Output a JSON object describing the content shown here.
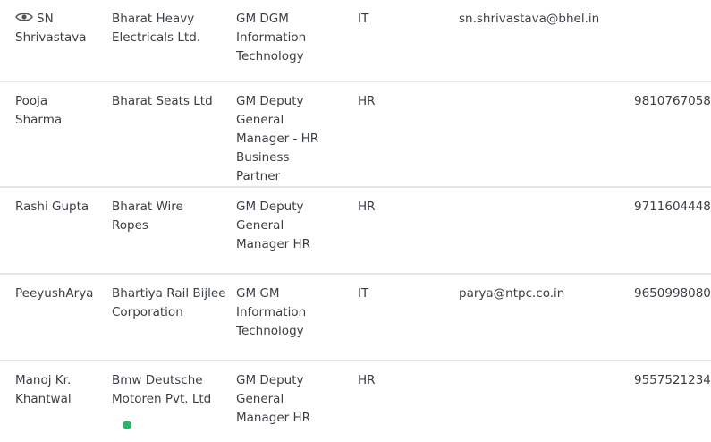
{
  "rows": [
    {
      "name_line1": "SN",
      "name_line2": "Shrivastava",
      "company": "Bharat Heavy Electricals Ltd.",
      "designation": "GM DGM Information Technology",
      "department": "IT",
      "email": "sn.shrivastava@bhel.in",
      "phone": ""
    },
    {
      "name": "Pooja Sharma",
      "company": "Bharat Seats Ltd",
      "designation": "GM Deputy General Manager - HR Business Partner",
      "department": "HR",
      "email": "",
      "phone": "9810767058"
    },
    {
      "name": "Rashi Gupta",
      "company": "Bharat Wire Ropes",
      "designation": "GM Deputy General Manager HR",
      "department": "HR",
      "email": "",
      "phone": "9711604448"
    },
    {
      "name": "PeeyushArya",
      "company": "Bhartiya Rail Bijlee Corporation",
      "designation": "GM GM Information Technology",
      "department": "IT",
      "email": "parya@ntpc.co.in",
      "phone": "9650998080"
    },
    {
      "name": "Manoj Kr. Khantwal",
      "company": "Bmw Deutsche Motoren Pvt. Ltd",
      "designation": "GM Deputy General Manager HR",
      "department": "HR",
      "email": "",
      "phone": "9557521234"
    }
  ],
  "icons": {
    "view": "eye-icon",
    "status": "online-status-dot"
  },
  "colors": {
    "status_dot": "#2db36b",
    "divider": "#e6e6e6",
    "text": "#3a3f44"
  }
}
